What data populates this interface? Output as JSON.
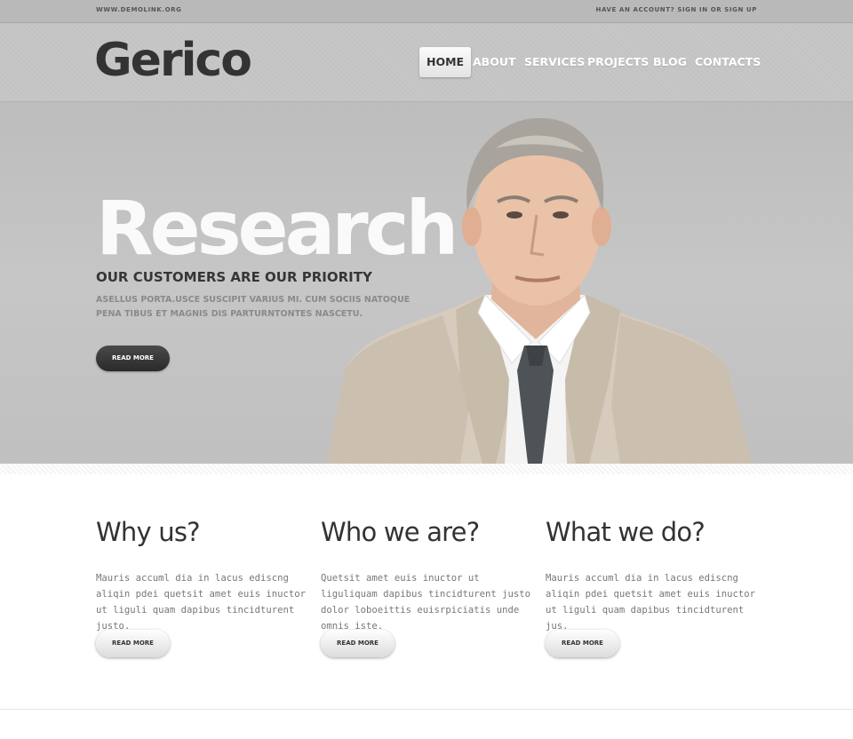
{
  "topbar": {
    "site": "WWW.DEMOLINK.ORG",
    "account_prefix": "HAVE AN ACCOUNT? ",
    "sign_in": "SIGN IN",
    "or": " OR ",
    "sign_up": "SIGN UP"
  },
  "header": {
    "logo": "Gerico",
    "nav": [
      "HOME",
      "ABOUT",
      "SERVICES",
      "PROJECTS",
      "BLOG",
      "CONTACTS"
    ],
    "active_nav": "HOME"
  },
  "hero": {
    "headline": "Research",
    "subheadline": "OUR CUSTOMERS ARE OUR PRIORITY",
    "description": "ASELLUS PORTA.USCE SUSCIPIT VARIUS MI. CUM SOCIIS NATOQUE PENA TIBUS ET MAGNIS DIS PARTURNTONTES NASCETU.",
    "button": "READ MORE"
  },
  "columns": [
    {
      "title": "Why us?",
      "text": "Mauris accuml dia in lacus ediscng aliqin pdei quetsit amet euis inuctor ut liguli quam dapibus tincidturent justo.",
      "button": "READ MORE"
    },
    {
      "title": "Who we are?",
      "text": "Quetsit amet euis inuctor ut liguliquam dapibus tincidturent justo dolor loboeittis euisrpiciatis unde omnis iste.",
      "button": "READ MORE"
    },
    {
      "title": "What we do?",
      "text": "Mauris accuml dia in lacus ediscng aliqin pdei quetsit amet euis inuctor ut liguli quam dapibus tincidturent jus.",
      "button": "READ MORE"
    }
  ],
  "colors": {
    "topbar_bg": "#b9b9b9",
    "hero_bg": "#c3c3c3",
    "headline": "#fafafa",
    "dark_button": "#333333",
    "suit": "#d7ccbf"
  }
}
